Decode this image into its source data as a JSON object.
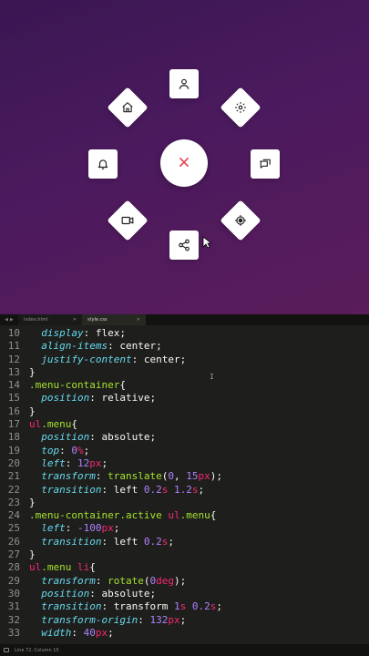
{
  "preview": {
    "center_button_icon": "close-icon",
    "center_icon_color": "#e0505a",
    "items": [
      {
        "name": "user-icon"
      },
      {
        "name": "home-icon"
      },
      {
        "name": "gear-icon"
      },
      {
        "name": "bell-icon"
      },
      {
        "name": "chat-icon"
      },
      {
        "name": "video-icon"
      },
      {
        "name": "location-icon"
      },
      {
        "name": "share-icon"
      }
    ]
  },
  "tabs": [
    {
      "label": "index.html",
      "active": false
    },
    {
      "label": "style.css",
      "active": true
    }
  ],
  "code_lines": [
    {
      "n": "10",
      "segs": [
        [
          "  ",
          ""
        ],
        [
          "display",
          "prop"
        ],
        [
          ": ",
          "punc"
        ],
        [
          "flex",
          "val"
        ],
        [
          ";",
          "punc"
        ]
      ]
    },
    {
      "n": "11",
      "segs": [
        [
          "  ",
          ""
        ],
        [
          "align-items",
          "prop"
        ],
        [
          ": ",
          "punc"
        ],
        [
          "center",
          "val"
        ],
        [
          ";",
          "punc"
        ]
      ]
    },
    {
      "n": "12",
      "segs": [
        [
          "  ",
          ""
        ],
        [
          "justify-content",
          "prop"
        ],
        [
          ": ",
          "punc"
        ],
        [
          "center",
          "val"
        ],
        [
          ";",
          "punc"
        ]
      ]
    },
    {
      "n": "13",
      "segs": [
        [
          "}",
          "punc"
        ]
      ]
    },
    {
      "n": "14",
      "segs": [
        [
          ".menu-container",
          "sel"
        ],
        [
          "{",
          "punc"
        ]
      ]
    },
    {
      "n": "15",
      "segs": [
        [
          "  ",
          ""
        ],
        [
          "position",
          "prop"
        ],
        [
          ": ",
          "punc"
        ],
        [
          "relative",
          "val"
        ],
        [
          ";",
          "punc"
        ]
      ]
    },
    {
      "n": "16",
      "segs": [
        [
          "}",
          "punc"
        ]
      ]
    },
    {
      "n": "17",
      "segs": [
        [
          "ul",
          "tag"
        ],
        [
          ".menu",
          "sel"
        ],
        [
          "{",
          "punc"
        ]
      ]
    },
    {
      "n": "18",
      "segs": [
        [
          "  ",
          ""
        ],
        [
          "position",
          "prop"
        ],
        [
          ": ",
          "punc"
        ],
        [
          "absolute",
          "val"
        ],
        [
          ";",
          "punc"
        ]
      ]
    },
    {
      "n": "19",
      "segs": [
        [
          "  ",
          ""
        ],
        [
          "top",
          "prop"
        ],
        [
          ": ",
          "punc"
        ],
        [
          "0",
          "num"
        ],
        [
          "%",
          "unit"
        ],
        [
          ";",
          "punc"
        ]
      ]
    },
    {
      "n": "20",
      "segs": [
        [
          "  ",
          ""
        ],
        [
          "left",
          "prop"
        ],
        [
          ": ",
          "punc"
        ],
        [
          "12",
          "num"
        ],
        [
          "px",
          "unit"
        ],
        [
          ";",
          "punc"
        ]
      ]
    },
    {
      "n": "21",
      "segs": [
        [
          "  ",
          ""
        ],
        [
          "transform",
          "prop"
        ],
        [
          ": ",
          "punc"
        ],
        [
          "translate",
          "fn"
        ],
        [
          "(",
          "punc"
        ],
        [
          "0",
          "num"
        ],
        [
          ", ",
          "punc"
        ],
        [
          "15",
          "num"
        ],
        [
          "px",
          "unit"
        ],
        [
          ");",
          "punc"
        ]
      ]
    },
    {
      "n": "22",
      "segs": [
        [
          "  ",
          ""
        ],
        [
          "transition",
          "prop"
        ],
        [
          ": ",
          "punc"
        ],
        [
          "left ",
          "val"
        ],
        [
          "0.2",
          "num"
        ],
        [
          "s",
          "unit"
        ],
        [
          " ",
          "punc"
        ],
        [
          "1.2",
          "num"
        ],
        [
          "s",
          "unit"
        ],
        [
          ";",
          "punc"
        ]
      ]
    },
    {
      "n": "23",
      "segs": [
        [
          "}",
          "punc"
        ]
      ]
    },
    {
      "n": "24",
      "segs": [
        [
          ".menu-container.active ",
          "sel"
        ],
        [
          "ul",
          "tag"
        ],
        [
          ".menu",
          "sel"
        ],
        [
          "{",
          "punc"
        ]
      ]
    },
    {
      "n": "25",
      "segs": [
        [
          "  ",
          ""
        ],
        [
          "left",
          "prop"
        ],
        [
          ": ",
          "punc"
        ],
        [
          "-100",
          "num"
        ],
        [
          "px",
          "unit"
        ],
        [
          ";",
          "punc"
        ]
      ]
    },
    {
      "n": "26",
      "segs": [
        [
          "  ",
          ""
        ],
        [
          "transition",
          "prop"
        ],
        [
          ": ",
          "punc"
        ],
        [
          "left ",
          "val"
        ],
        [
          "0.2",
          "num"
        ],
        [
          "s",
          "unit"
        ],
        [
          ";",
          "punc"
        ]
      ]
    },
    {
      "n": "27",
      "segs": [
        [
          "}",
          "punc"
        ]
      ]
    },
    {
      "n": "28",
      "segs": [
        [
          "ul",
          "tag"
        ],
        [
          ".menu ",
          "sel"
        ],
        [
          "li",
          "tag"
        ],
        [
          "{",
          "punc"
        ]
      ]
    },
    {
      "n": "29",
      "segs": [
        [
          "  ",
          ""
        ],
        [
          "transform",
          "prop"
        ],
        [
          ": ",
          "punc"
        ],
        [
          "rotate",
          "fn"
        ],
        [
          "(",
          "punc"
        ],
        [
          "0",
          "num"
        ],
        [
          "deg",
          "unit"
        ],
        [
          ");",
          "punc"
        ]
      ]
    },
    {
      "n": "30",
      "segs": [
        [
          "  ",
          ""
        ],
        [
          "position",
          "prop"
        ],
        [
          ": ",
          "punc"
        ],
        [
          "absolute",
          "val"
        ],
        [
          ";",
          "punc"
        ]
      ]
    },
    {
      "n": "31",
      "segs": [
        [
          "  ",
          ""
        ],
        [
          "transition",
          "prop"
        ],
        [
          ": ",
          "punc"
        ],
        [
          "transform ",
          "val"
        ],
        [
          "1",
          "num"
        ],
        [
          "s",
          "unit"
        ],
        [
          " ",
          "punc"
        ],
        [
          "0.2",
          "num"
        ],
        [
          "s",
          "unit"
        ],
        [
          ";",
          "punc"
        ]
      ]
    },
    {
      "n": "32",
      "segs": [
        [
          "  ",
          ""
        ],
        [
          "transform-origin",
          "prop"
        ],
        [
          ": ",
          "punc"
        ],
        [
          "132",
          "num"
        ],
        [
          "px",
          "unit"
        ],
        [
          ";",
          "punc"
        ]
      ]
    },
    {
      "n": "33",
      "segs": [
        [
          "  ",
          ""
        ],
        [
          "width",
          "prop"
        ],
        [
          ": ",
          "punc"
        ],
        [
          "40",
          "num"
        ],
        [
          "px",
          "unit"
        ],
        [
          ";",
          "punc"
        ]
      ]
    }
  ],
  "status": {
    "position": "Line 72, Column 15"
  }
}
